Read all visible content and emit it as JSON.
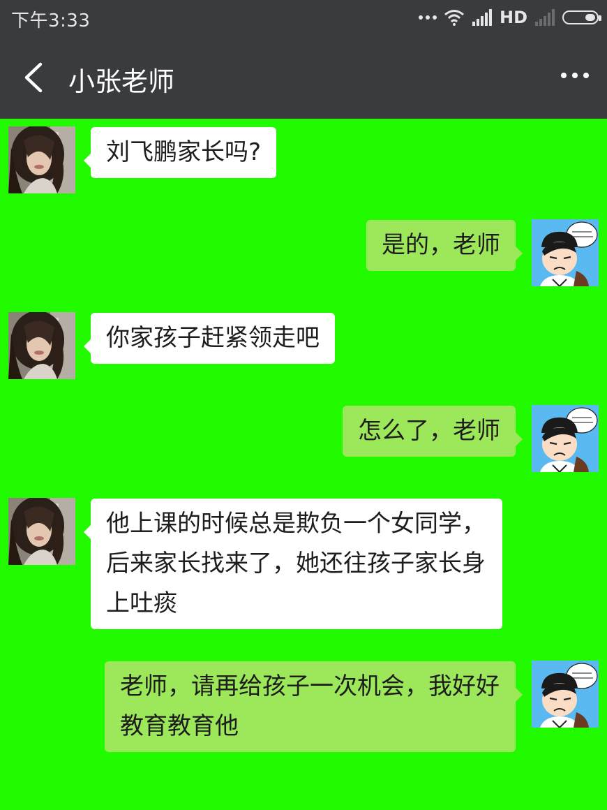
{
  "status_bar": {
    "time": "下午3:33",
    "network": "HD",
    "icons": [
      "more-dots-icon",
      "wifi-icon",
      "signal-icon",
      "signal-empty-icon",
      "battery-icon"
    ]
  },
  "header": {
    "title": "小张老师",
    "back_icon": "chevron-left-icon",
    "menu_icon": "more-dots-icon"
  },
  "colors": {
    "chat_background": "#22fa00",
    "incoming_bubble": "#ffffff",
    "outgoing_bubble": "#9ce85a",
    "header_background": "#393b3e"
  },
  "messages": [
    {
      "sender": "teacher",
      "text": "刘飞鹏家长吗?"
    },
    {
      "sender": "parent",
      "text": "是的，老师"
    },
    {
      "sender": "teacher",
      "text": "你家孩子赶紧领走吧"
    },
    {
      "sender": "parent",
      "text": "怎么了，老师"
    },
    {
      "sender": "teacher",
      "text": "他上课的时候总是欺负一个女同学，后来家长找来了，她还往孩子家长身上吐痰"
    },
    {
      "sender": "parent",
      "text": "老师，请再给孩子一次机会，我好好教育教育他"
    }
  ]
}
